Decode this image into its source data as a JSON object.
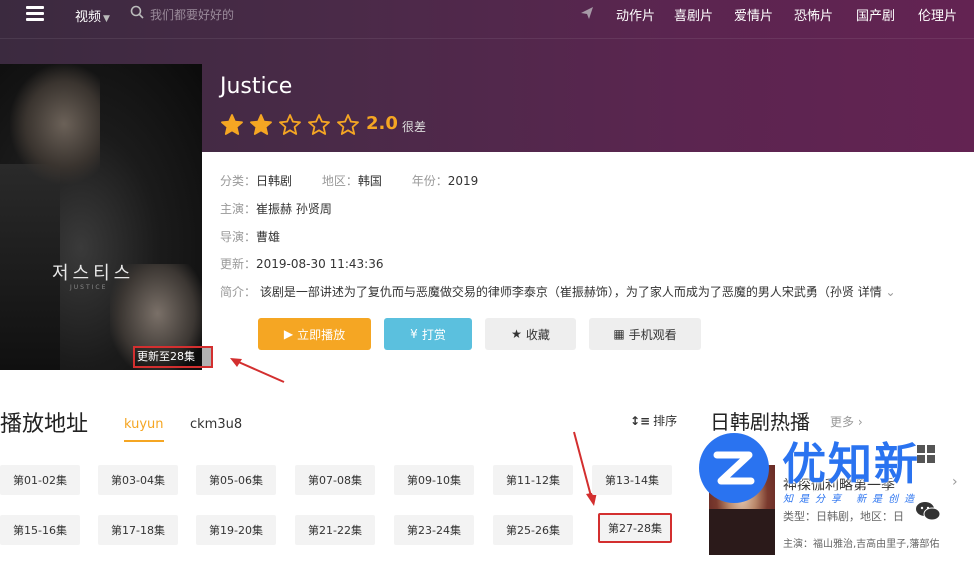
{
  "nav": {
    "category": "视频",
    "search_placeholder": "我们都要好好的",
    "links": [
      "动作片",
      "喜剧片",
      "爱情片",
      "恐怖片",
      "国产剧",
      "伦理片"
    ]
  },
  "poster": {
    "title_kr": "저스티스",
    "subtitle": "JUSTICE",
    "update_badge": "更新至28集"
  },
  "detail": {
    "title": "Justice",
    "rating_stars": 2,
    "rating_max": 5,
    "score": "2.0",
    "score_text": "很差",
    "category_label": "分类：",
    "category": "日韩剧",
    "region_label": "地区：",
    "region": "韩国",
    "year_label": "年份：",
    "year": "2019",
    "cast_label": "主演：",
    "cast": "崔振赫 孙贤周",
    "director_label": "导演：",
    "director": "曹雄",
    "updated_label": "更新：",
    "updated": "2019-08-30 11:43:36",
    "intro_label": "简介：",
    "intro": "该剧是一部讲述为了复仇而与恶魔做交易的律师李泰京（崔振赫饰），为了家人而成为了恶魔的男人宋武勇（孙贤",
    "intro_more": "详情"
  },
  "buttons": {
    "play": "立即播放",
    "tip": "打赏",
    "favorite": "收藏",
    "mobile": "手机观看"
  },
  "play": {
    "heading": "播放地址",
    "sources": [
      "kuyun",
      "ckm3u8"
    ],
    "sort_label": "排序",
    "episodes": [
      "第01-02集",
      "第03-04集",
      "第05-06集",
      "第07-08集",
      "第09-10集",
      "第11-12集",
      "第13-14集",
      "第15-16集",
      "第17-18集",
      "第19-20集",
      "第21-22集",
      "第23-24集",
      "第25-26集",
      "第27-28集"
    ]
  },
  "side": {
    "heading": "日韩剧热播",
    "more": "更多",
    "item_title": "神探伽利略第一季",
    "item_type": "类型：日韩剧，地区：日",
    "item_cast": "主演：福山雅治,吉高由里子,藩部佑"
  },
  "watermark": {
    "brand": "优知新",
    "slogan": "知是分享 新是创造"
  },
  "colors": {
    "accent": "#f5a623",
    "tip": "#5bc0de",
    "highlight": "#d32f2f",
    "watermark": "#2a73f0"
  }
}
